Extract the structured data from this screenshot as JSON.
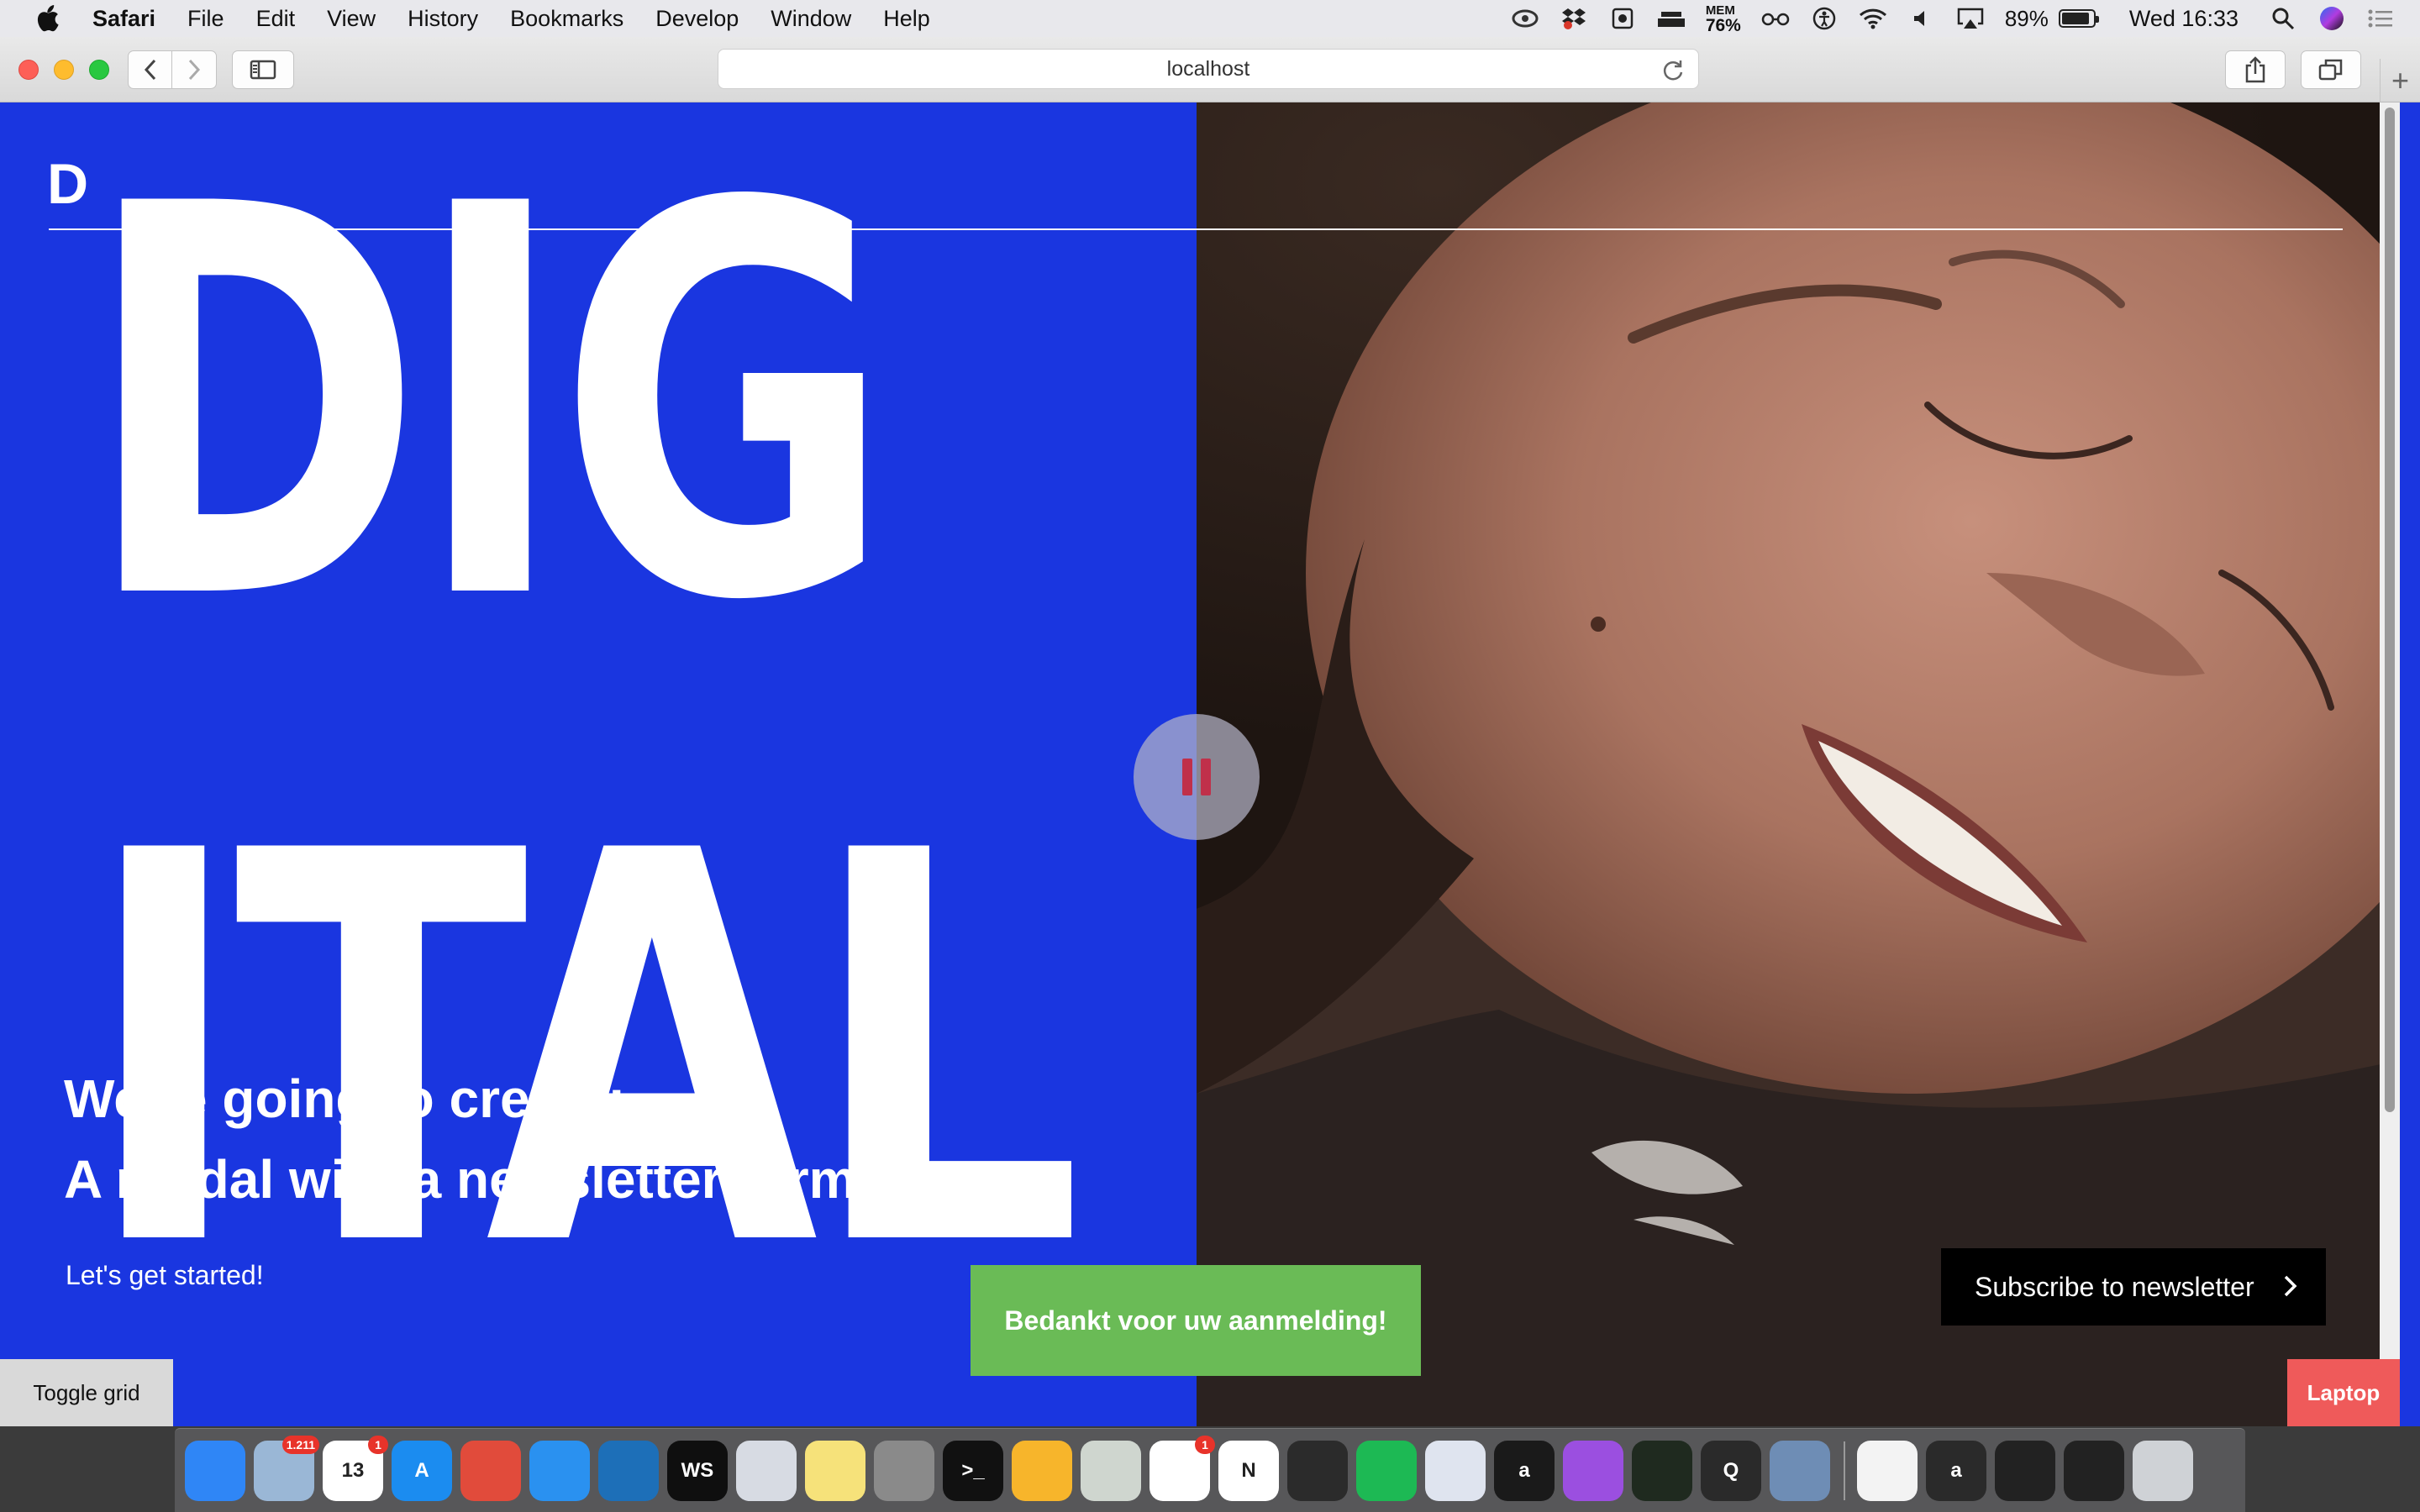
{
  "menubar": {
    "app_name": "Safari",
    "menus": [
      "File",
      "Edit",
      "View",
      "History",
      "Bookmarks",
      "Develop",
      "Window",
      "Help"
    ],
    "mem_label": "MEM",
    "mem_value": "76%",
    "battery_percent": "89%",
    "battery_level": 0.89,
    "clock": "Wed 16:33"
  },
  "browser": {
    "url": "localhost"
  },
  "page": {
    "logo_letter": "D",
    "big_word_line1": "DIG",
    "big_word_line2": "ITAL",
    "headline_line1": "We're going to create:",
    "headline_line2": "A modal with a newsletter form!",
    "lead": "Let's get started!",
    "toast": "Bedankt voor uw aanmelding!",
    "subscribe_button": "Subscribe to newsletter",
    "toggle_grid": "Toggle grid",
    "breakpoint_badge": "Laptop",
    "colors": {
      "accent_blue": "#1a36e0",
      "toast_green": "#6abb56",
      "badge_red": "#ef5a5a",
      "pause_icon": "#c0304a"
    }
  },
  "dock": {
    "items": [
      {
        "name": "finder-icon",
        "color": "#2f86f6",
        "label": ""
      },
      {
        "name": "mail-icon",
        "color": "#9ab7d6",
        "label": "",
        "badge": "1.211"
      },
      {
        "name": "calendar-icon",
        "color": "#ffffff",
        "label": "13",
        "badge": "1"
      },
      {
        "name": "app-store-icon",
        "color": "#1b8cf0",
        "label": "A"
      },
      {
        "name": "chrome-icon",
        "color": "#e14b3b",
        "label": ""
      },
      {
        "name": "safari-icon",
        "color": "#2a91f0",
        "label": ""
      },
      {
        "name": "vscode-icon",
        "color": "#1d6fb8",
        "label": ""
      },
      {
        "name": "webstorm-icon",
        "color": "#0f0f0f",
        "label": "WS"
      },
      {
        "name": "preview-icon",
        "color": "#d7dbe3",
        "label": ""
      },
      {
        "name": "notes-icon",
        "color": "#f6e27a",
        "label": ""
      },
      {
        "name": "system-preferences-icon",
        "color": "#8a8a8a",
        "label": ""
      },
      {
        "name": "terminal-icon",
        "color": "#111111",
        "label": ">_"
      },
      {
        "name": "sketch-icon",
        "color": "#f7b52b",
        "label": ""
      },
      {
        "name": "no-entry-app-icon",
        "color": "#cfd6cf",
        "label": ""
      },
      {
        "name": "slack-icon",
        "color": "#ffffff",
        "label": "",
        "badge": "1"
      },
      {
        "name": "nvalt-icon",
        "color": "#ffffff",
        "label": "N"
      },
      {
        "name": "git-client-icon",
        "color": "#2b2b2b",
        "label": ""
      },
      {
        "name": "spotify-icon",
        "color": "#1db954",
        "label": ""
      },
      {
        "name": "blocked-app-icon",
        "color": "#dfe4ef",
        "label": ""
      },
      {
        "name": "framer-app-icon",
        "color": "#1a1a1a",
        "label": "a"
      },
      {
        "name": "podcasts-icon",
        "color": "#9b4fe0",
        "label": ""
      },
      {
        "name": "activity-monitor-icon",
        "color": "#1f2a1f",
        "label": ""
      },
      {
        "name": "quicktime-icon",
        "color": "#2a2a2a",
        "label": "Q"
      },
      {
        "name": "photo-preview-icon",
        "color": "#6e8db5",
        "label": ""
      }
    ],
    "right_items": [
      {
        "name": "document-docx-icon",
        "color": "#f3f3f3",
        "label": ""
      },
      {
        "name": "framer-folder-icon",
        "color": "#2a2a2a",
        "label": "a"
      },
      {
        "name": "window-thumbnail-icon",
        "color": "#222222",
        "label": ""
      },
      {
        "name": "window-thumbnail-2-icon",
        "color": "#222222",
        "label": ""
      },
      {
        "name": "trash-icon",
        "color": "#cfd2d6",
        "label": ""
      }
    ]
  }
}
